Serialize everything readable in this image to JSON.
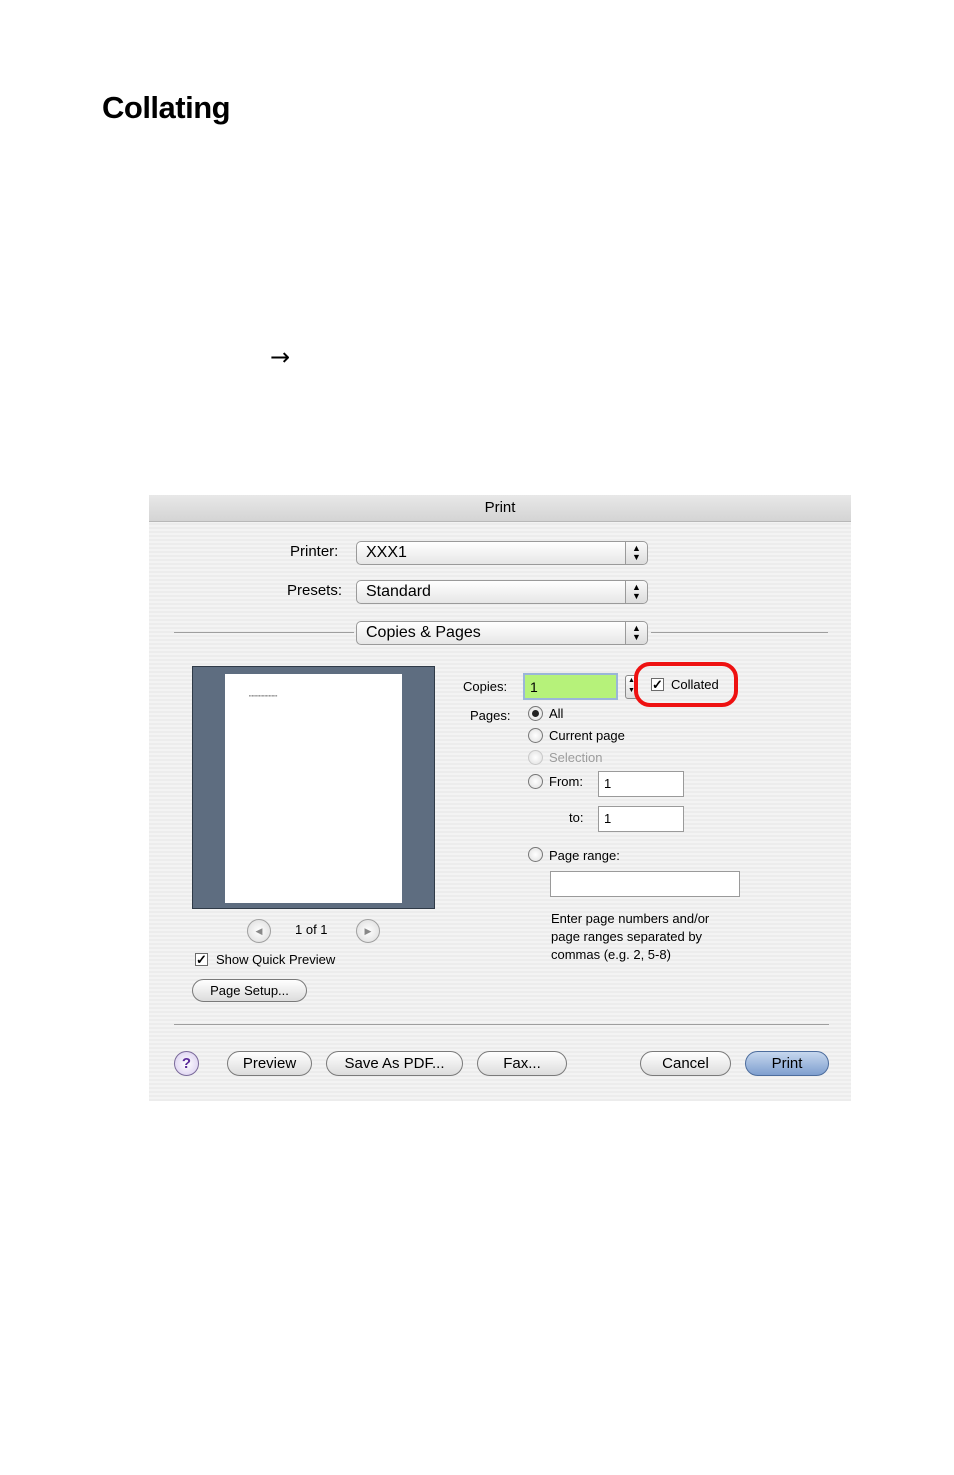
{
  "page": {
    "heading": "Collating",
    "arrow": "→"
  },
  "dialog": {
    "title": "Print",
    "printer_label": "Printer:",
    "printer_value": "XXX1",
    "presets_label": "Presets:",
    "presets_value": "Standard",
    "section_value": "Copies & Pages",
    "preview": {
      "page_counter": "1 of 1",
      "show_quick_preview_label": "Show Quick Preview",
      "show_quick_preview_checked": true,
      "page_setup_label": "Page Setup..."
    },
    "copies_label": "Copies:",
    "copies_value": "1",
    "collated_label": "Collated",
    "collated_checked": true,
    "pages_label": "Pages:",
    "pages_options": {
      "all": "All",
      "current_page": "Current page",
      "selection": "Selection",
      "from": "From:",
      "to": "to:",
      "page_range": "Page range:"
    },
    "pages_selected": "All",
    "from_value": "1",
    "to_value": "1",
    "page_range_value": "",
    "help_text_1": "Enter page numbers and/or",
    "help_text_2": "page ranges separated by",
    "help_text_3": "commas (e.g. 2, 5-8)",
    "buttons": {
      "help": "?",
      "preview": "Preview",
      "save_as_pdf": "Save As PDF...",
      "fax": "Fax...",
      "cancel": "Cancel",
      "print": "Print"
    },
    "highlight_color": "#ee1111",
    "copies_field_color": "#b6f27a"
  }
}
